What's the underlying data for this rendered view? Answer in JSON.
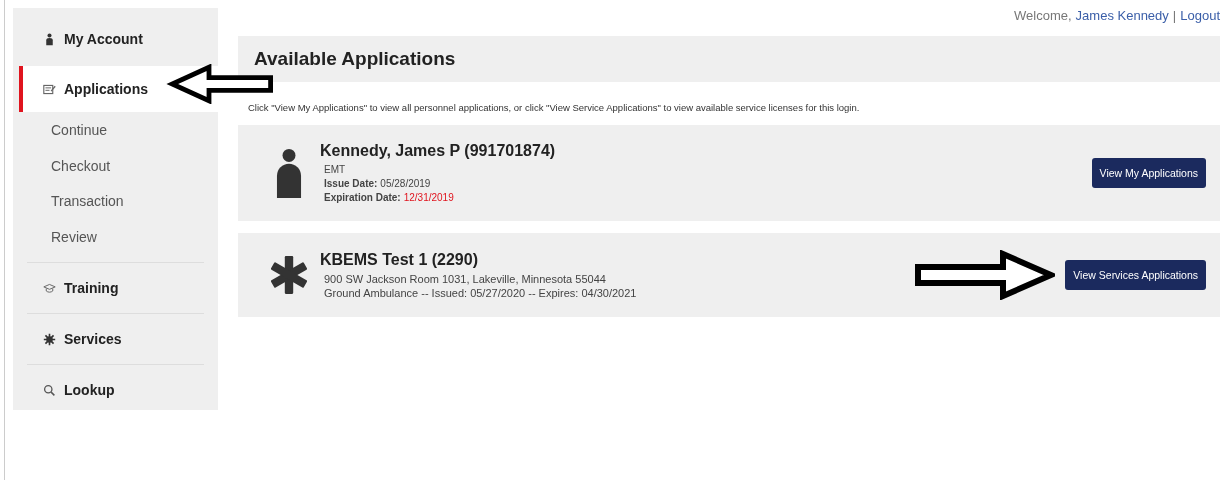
{
  "header": {
    "welcome": "Welcome,",
    "user": "James Kennedy",
    "separator": "|",
    "logout": "Logout"
  },
  "sidebar": {
    "sections": [
      {
        "label": "My Account",
        "selected": false
      },
      {
        "label": "Applications",
        "selected": true,
        "children": [
          {
            "label": "Continue"
          },
          {
            "label": "Checkout"
          },
          {
            "label": "Transaction"
          },
          {
            "label": "Review"
          }
        ]
      },
      {
        "label": "Training",
        "selected": false
      },
      {
        "label": "Services",
        "selected": false
      },
      {
        "label": "Lookup",
        "selected": false
      }
    ]
  },
  "page": {
    "title": "Available Applications",
    "instructions": "Click \"View My Applications\" to view all personnel applications, or click \"View Service Applications\" to view available service licenses for this login."
  },
  "cards": [
    {
      "kind": "person",
      "title": "Kennedy, James P (991701874)",
      "lines": [
        {
          "text": "EMT"
        },
        {
          "label": "Issue Date:",
          "value": "05/28/2019",
          "alert": false
        },
        {
          "label": "Expiration Date:",
          "value": "12/31/2019",
          "alert": true
        }
      ],
      "button": "View My Applications",
      "pointed": false
    },
    {
      "kind": "service",
      "title": "KBEMS Test 1 (2290)",
      "lines": [
        {
          "text": "900 SW Jackson Room 1031, Lakeville, Minnesota 55044"
        },
        {
          "text": "Ground Ambulance -- Issued: 05/27/2020 -- Expires: 04/30/2021"
        }
      ],
      "button": "View Services Applications",
      "pointed": true
    }
  ]
}
